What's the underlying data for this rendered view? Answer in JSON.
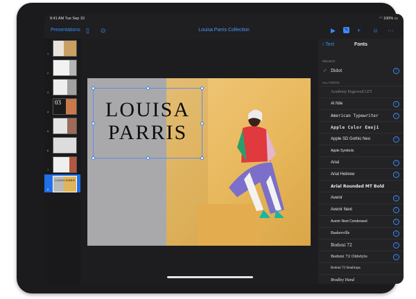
{
  "status": {
    "time": "9:41 AM  Tue Sep 10",
    "battery": "100%"
  },
  "toolbar": {
    "presentations_label": "Presentations",
    "doc_title": "Louisa Parris Collection",
    "icons": [
      "sidebar-icon",
      "more-icon",
      "play-icon",
      "format-brush-icon",
      "plus-icon",
      "collaborate-icon",
      "ellipsis-icon"
    ]
  },
  "slides": [
    {
      "num": "1"
    },
    {
      "num": "2"
    },
    {
      "num": "3"
    },
    {
      "num": "4"
    },
    {
      "num": "5"
    },
    {
      "num": "6"
    },
    {
      "num": "7"
    },
    {
      "num": "8",
      "caption": "LOUISA PARRIS"
    }
  ],
  "slide": {
    "title_line1": "LOUISA",
    "title_line2": "PARRIS"
  },
  "panel": {
    "back_label": "Text",
    "title": "Fonts",
    "recent_header": "RECENT",
    "all_fonts_header": "ALL FONTS",
    "recent": [
      {
        "name": "Didot",
        "selected": true
      }
    ],
    "fonts": [
      "Academy Engraved LET",
      "Al Nile",
      "American Typewriter",
      "Apple  Color  Emoji",
      "Apple SD Gothic Neo",
      "Apple Symbols",
      "Arial",
      "Arial Hebrew",
      "Arial Rounded MT Bold",
      "Avenir",
      "Avenir Next",
      "Avenir Next Condensed",
      "Baskerville",
      "Bodoni 72",
      "Bodoni 72 Oldstyle",
      "Bodoni 72 Smallcaps",
      "Bradley Hand"
    ]
  },
  "colors": {
    "accent": "#3b8cff",
    "canvas_bg": "#1d1d1f",
    "panel_bg": "#232325"
  }
}
